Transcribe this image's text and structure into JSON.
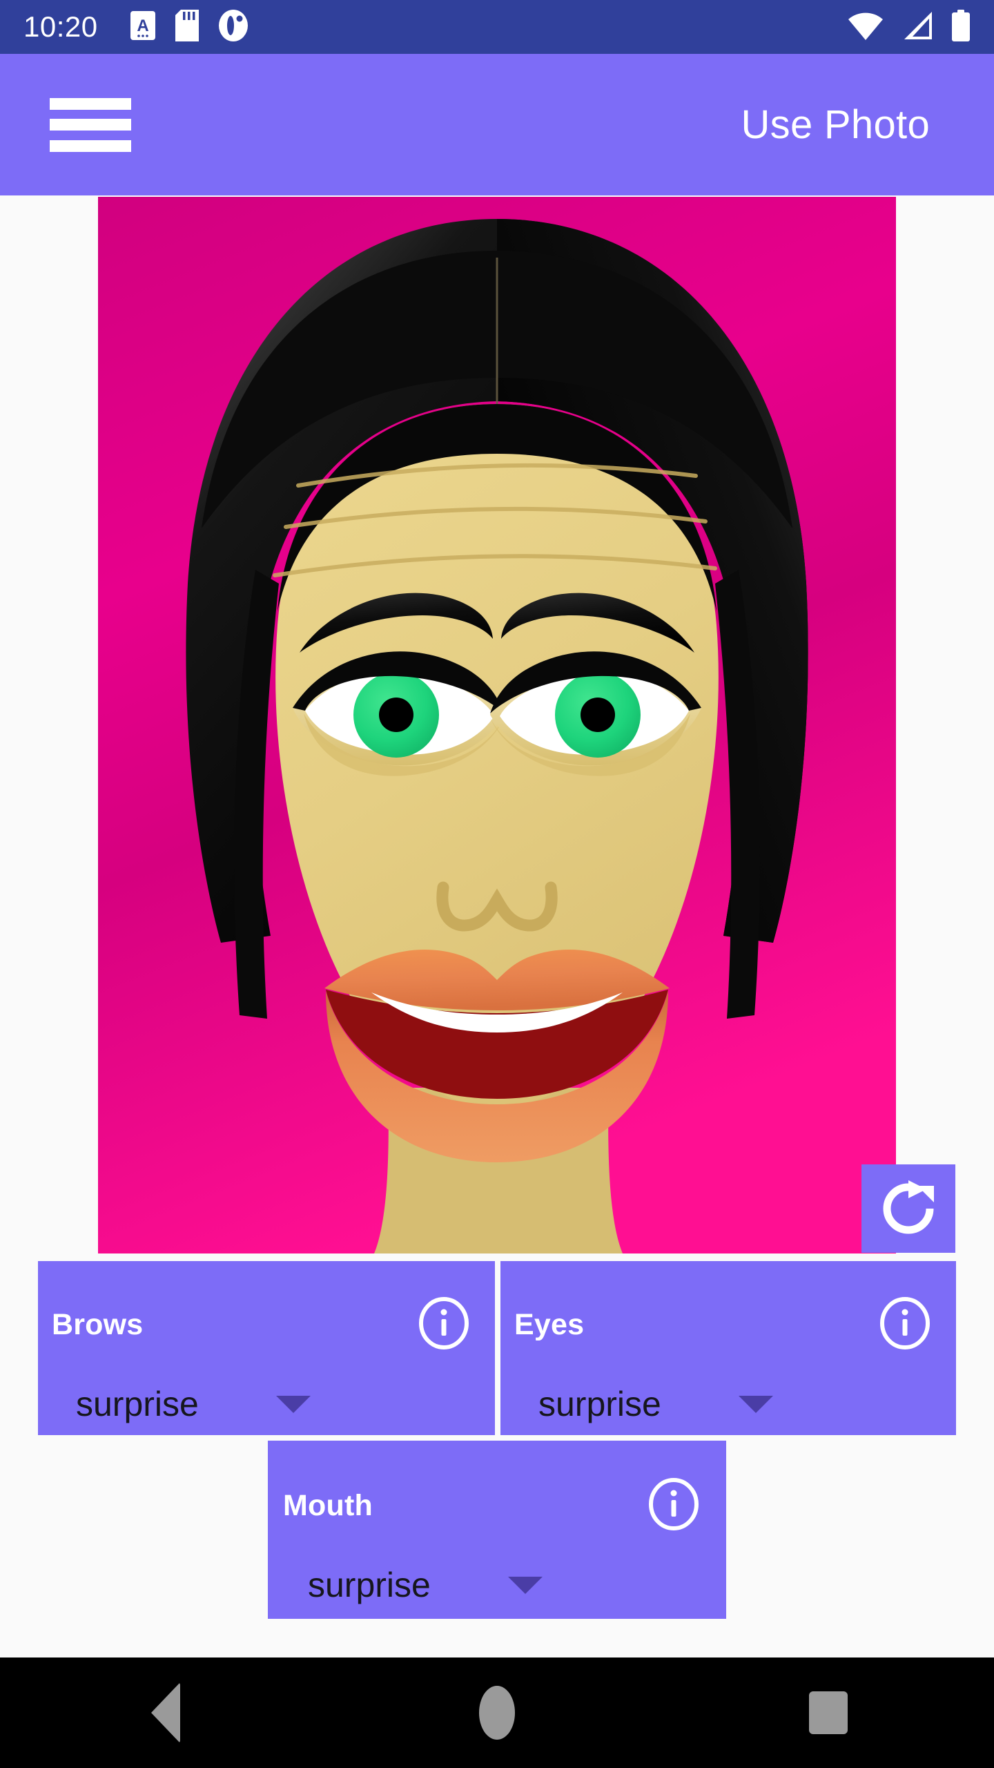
{
  "status_bar": {
    "time": "10:20",
    "left_icons": [
      "alarm-a-icon",
      "sd-card-icon",
      "app-notification-icon"
    ],
    "right_icons": [
      "wifi-icon",
      "cellular-signal-icon",
      "battery-icon"
    ],
    "background_color": "#30409b"
  },
  "app_bar": {
    "menu_icon": "hamburger-menu-icon",
    "title": "Use Photo",
    "background_color": "#7d6cf7",
    "text_color": "#ffffff"
  },
  "photo": {
    "description": "illustrated cartoon face on magenta background",
    "background_color": "#e8008c",
    "skin_color": "#e8d288",
    "hair_color": "#0a0a0a",
    "iris_color": "#1ed47c",
    "pupil_color": "#000000",
    "sclera_color": "#ffffff",
    "lip_color": "#e8834f",
    "mouth_interior_color": "#8f0e10",
    "teeth_color": "#ffffff",
    "brow_color": "#111111",
    "nose_line_color": "#c8ab5c"
  },
  "refresh_button": {
    "icon": "refresh-rotate-icon",
    "background_color": "#7d6cf7",
    "icon_color": "#ffffff"
  },
  "controls": [
    {
      "id": "brows",
      "label": "Brows",
      "info_icon": "info-circle-icon",
      "dropdown": {
        "value": "surprise",
        "arrow_icon": "chevron-down-icon"
      }
    },
    {
      "id": "eyes",
      "label": "Eyes",
      "info_icon": "info-circle-icon",
      "dropdown": {
        "value": "surprise",
        "arrow_icon": "chevron-down-icon"
      }
    },
    {
      "id": "mouth",
      "label": "Mouth",
      "info_icon": "info-circle-icon",
      "dropdown": {
        "value": "surprise",
        "arrow_icon": "chevron-down-icon"
      }
    }
  ],
  "nav_bar": {
    "background_color": "#000000",
    "buttons": [
      {
        "id": "back",
        "icon": "back-triangle-icon"
      },
      {
        "id": "home",
        "icon": "home-circle-icon"
      },
      {
        "id": "recents",
        "icon": "recents-square-icon"
      }
    ]
  }
}
